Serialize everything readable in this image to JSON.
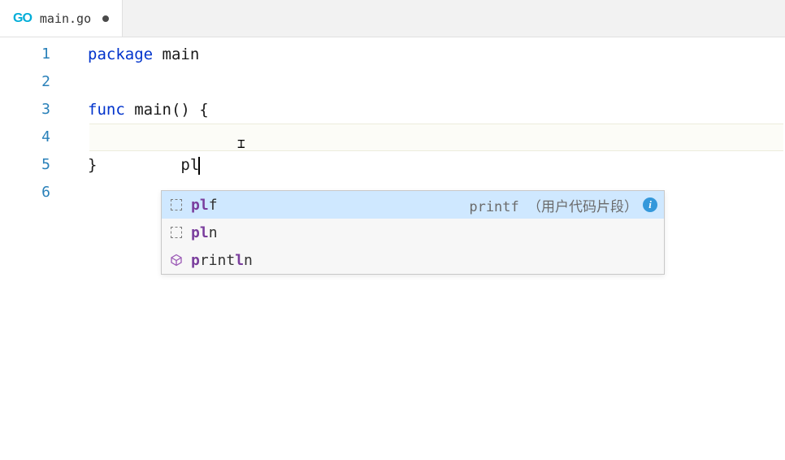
{
  "tab": {
    "icon_label": "GO",
    "filename": "main.go",
    "dirty": true
  },
  "gutter": {
    "lines": [
      "1",
      "2",
      "3",
      "4",
      "5",
      "6"
    ]
  },
  "code": {
    "line1": {
      "kw": "package",
      "ident": " main"
    },
    "line3": {
      "kw": "func",
      "ident": " main",
      "rest": "() {"
    },
    "line4": {
      "indent": "    ",
      "typed": "pl"
    },
    "line5": {
      "text": "}"
    }
  },
  "suggest": {
    "items": [
      {
        "kind": "snippet",
        "match": "pl",
        "rest": "f",
        "detail": "printf （用户代码片段）",
        "info": true,
        "selected": true
      },
      {
        "kind": "snippet",
        "match": "pl",
        "rest": "n",
        "detail": "",
        "info": false,
        "selected": false
      },
      {
        "kind": "func",
        "match_pre": "p",
        "mid": "rint",
        "match_post": "l",
        "tail": "n",
        "detail": "",
        "info": false,
        "selected": false
      }
    ]
  },
  "cursor_ibeam_glyph": "I"
}
